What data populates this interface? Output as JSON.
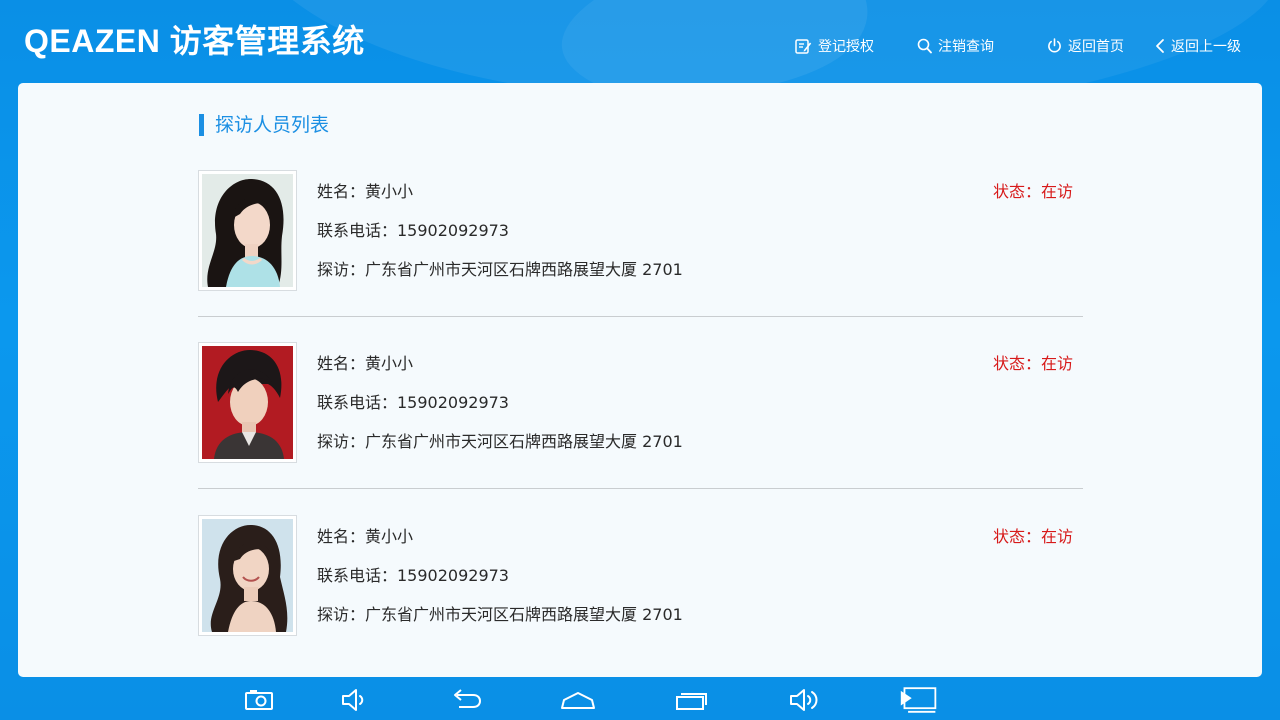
{
  "app": {
    "brand": "QEAZEN 访客管理系统"
  },
  "nav": [
    {
      "label": "登记授权",
      "icon": "edit-icon"
    },
    {
      "label": "注销查询",
      "icon": "search-icon"
    },
    {
      "label": "返回首页",
      "icon": "power-icon"
    },
    {
      "label": "返回上一级",
      "icon": "chevron-left-icon"
    }
  ],
  "section": {
    "title": "探访人员列表"
  },
  "visitors": [
    {
      "name": "姓名：黄小小",
      "phone": "联系电话：15902092973",
      "visit": "探访：广东省广州市天河区石牌西路展望大厦 2701",
      "status": "状态：在访"
    },
    {
      "name": "姓名：黄小小",
      "phone": "联系电话：15902092973",
      "visit": "探访：广东省广州市天河区石牌西路展望大厦 2701",
      "status": "状态：在访"
    },
    {
      "name": "姓名：黄小小",
      "phone": "联系电话：15902092973",
      "visit": "探访：广东省广州市天河区石牌西路展望大厦 2701",
      "status": "状态：在访"
    }
  ],
  "colors": {
    "accent": "#1b8fe3",
    "status": "#d71a1a",
    "header_bg": "#0a8fe6"
  },
  "system_bar": [
    "screenshot-icon",
    "volume-down-icon",
    "back-icon",
    "home-icon",
    "recent-apps-icon",
    "volume-up-icon",
    "screen-cast-icon"
  ]
}
